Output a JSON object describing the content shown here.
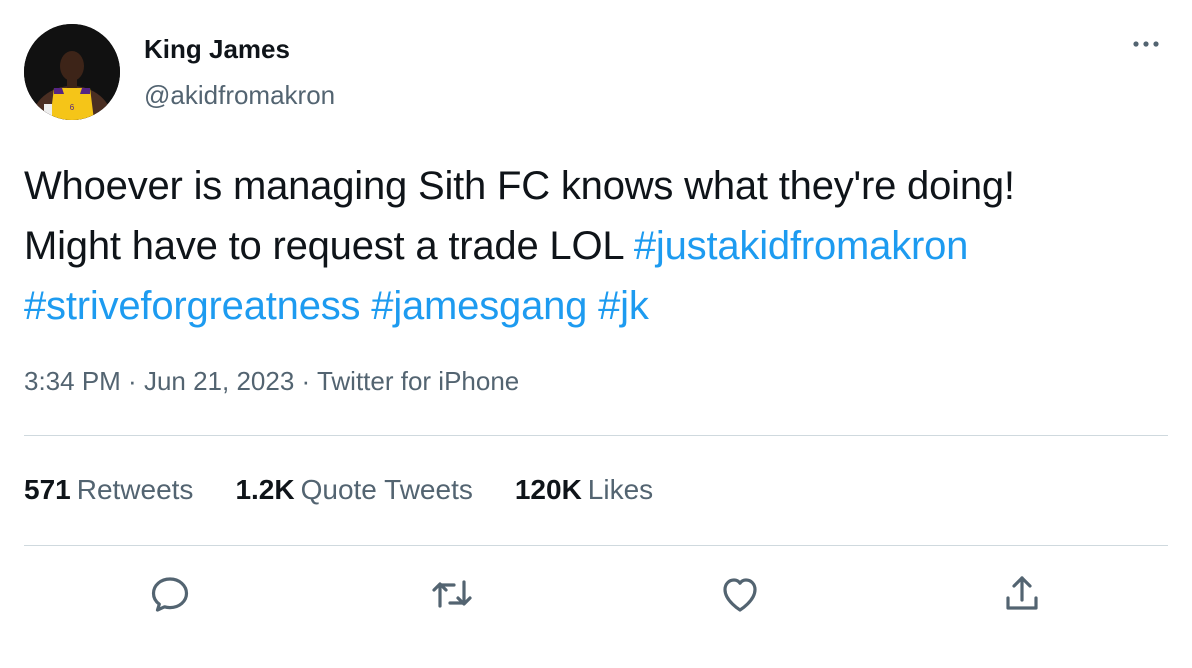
{
  "user": {
    "display_name": "King James",
    "handle": "@akidfromakron",
    "avatar_icon": "player-photo-avatar"
  },
  "tweet": {
    "text_line1": "Whoever is managing Sith FC knows what they're doing!",
    "text_line2_plain": "Might have to request a trade LOL ",
    "hashtags": [
      "#justakidfromakron",
      "#striveforgreatness",
      "#jamesgang",
      "#jk"
    ]
  },
  "meta": {
    "time": "3:34 PM",
    "separator": " · ",
    "date": "Jun 21, 2023",
    "source": "Twitter for iPhone"
  },
  "stats": {
    "retweets_count": "571",
    "retweets_label": "Retweets",
    "quotes_count": "1.2K",
    "quotes_label": "Quote Tweets",
    "likes_count": "120K",
    "likes_label": "Likes"
  },
  "icons": {
    "more": "more-horizontal-icon",
    "reply": "reply-icon",
    "retweet": "retweet-icon",
    "like": "heart-icon",
    "share": "share-icon"
  },
  "colors": {
    "accent": "#1d9bf0",
    "text": "#0f1419",
    "secondary": "#536471",
    "divider": "#cfd9de"
  }
}
